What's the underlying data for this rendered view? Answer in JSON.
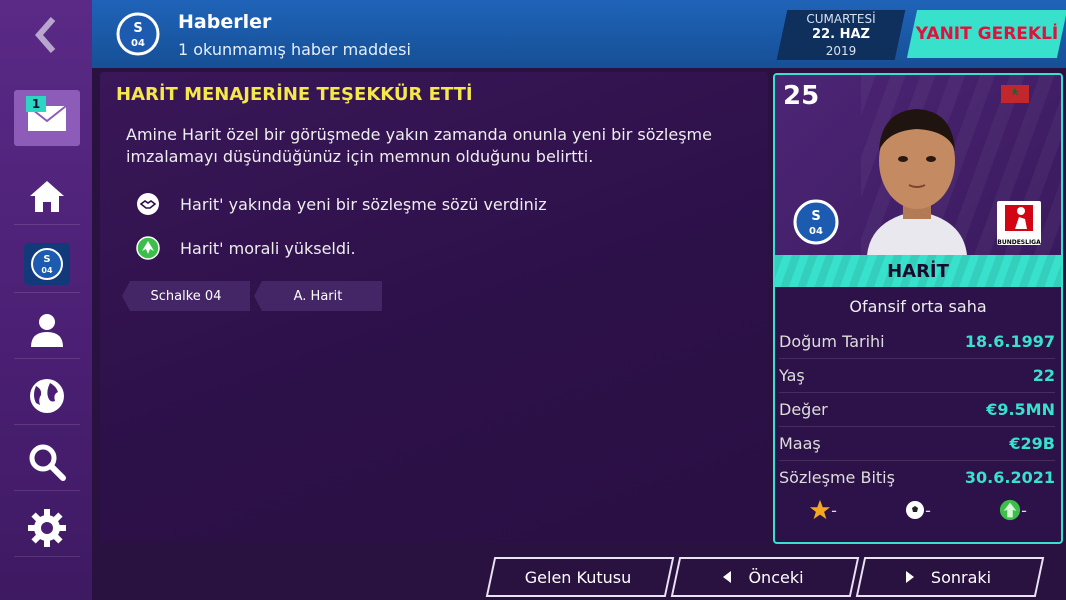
{
  "header": {
    "title": "Haberler",
    "subtitle": "1 okunmamış haber maddesi",
    "date": {
      "day": "CUMARTESİ",
      "date": "22. HAZ",
      "year": "2019"
    },
    "reply": "YANIT GEREKLİ"
  },
  "sidebar": {
    "inbox_badge": "1",
    "items": [
      "inbox",
      "home",
      "club",
      "squad",
      "world",
      "search",
      "settings"
    ]
  },
  "message": {
    "title": "HARİT MENAJERİNE TEŞEKKÜR ETTİ",
    "body": "Amine Harit özel bir görüşmede yakın zamanda onunla yeni bir sözleşme imzalamayı düşündüğünüz için memnun olduğunu belirtti.",
    "effects": [
      {
        "icon": "handshake-icon",
        "text": "Harit' yakında yeni bir sözleşme sözü verdiniz"
      },
      {
        "icon": "arrow-up-icon",
        "text": "Harit' morali yükseldi."
      }
    ],
    "tags": [
      "Schalke 04",
      "A. Harit"
    ]
  },
  "player": {
    "number": "25",
    "name": "HARİT",
    "position": "Ofansif orta saha",
    "club_crest_text": "04",
    "league": "BUNDESLIGA",
    "stats": [
      {
        "label": "Doğum Tarihi",
        "value": "18.6.1997"
      },
      {
        "label": "Yaş",
        "value": "22"
      },
      {
        "label": "Değer",
        "value": "€9.5MN"
      },
      {
        "label": "Maaş",
        "value": "€29B"
      },
      {
        "label": "Sözleşme Bitiş",
        "value": "30.6.2021"
      }
    ],
    "ratings": [
      "-",
      "-",
      "-"
    ]
  },
  "buttons": {
    "inbox": "Gelen Kutusu",
    "prev": "Önceki",
    "next": "Sonraki"
  },
  "colors": {
    "accent": "#38e1cc",
    "title": "#f5e84a",
    "reply": "#e0123c",
    "header": "#1f63b8"
  }
}
